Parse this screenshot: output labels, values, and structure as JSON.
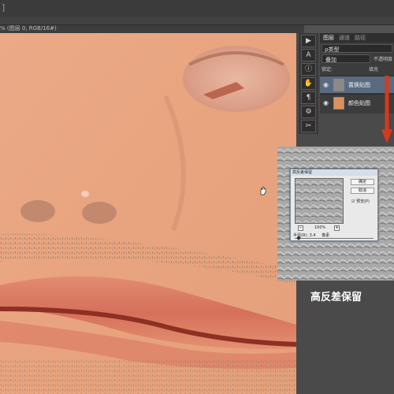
{
  "document": {
    "tab_label": "% (图层 0, RGB/16#)"
  },
  "layers_panel": {
    "tabs": [
      "图层",
      "通道",
      "路径"
    ],
    "filter_kind": "ρ类型",
    "blend_mode": "叠加",
    "opacity_label": "不透明度",
    "lock_label": "锁定:",
    "fill_label": "填充",
    "layers": [
      {
        "name": "置换贴图",
        "visible": true,
        "selected": true
      },
      {
        "name": "颜色贴图",
        "visible": true,
        "selected": false
      }
    ]
  },
  "tools": [
    "▶",
    "A",
    "ⓘ",
    "✋",
    "¶",
    "⚙",
    "✂"
  ],
  "dialog": {
    "title": "高反差保留",
    "ok_label": "确定",
    "cancel_label": "取消",
    "preview_label": "☑ 预览(P)",
    "zoom_value": "100%",
    "radius_label": "半径(R): 3.4",
    "radius_unit": "像素"
  },
  "caption": "高反差保留",
  "colors": {
    "skin": "#e8a47e",
    "lip": "#c0503e",
    "arrow": "#d8391a",
    "selection": "#5a6a80"
  }
}
